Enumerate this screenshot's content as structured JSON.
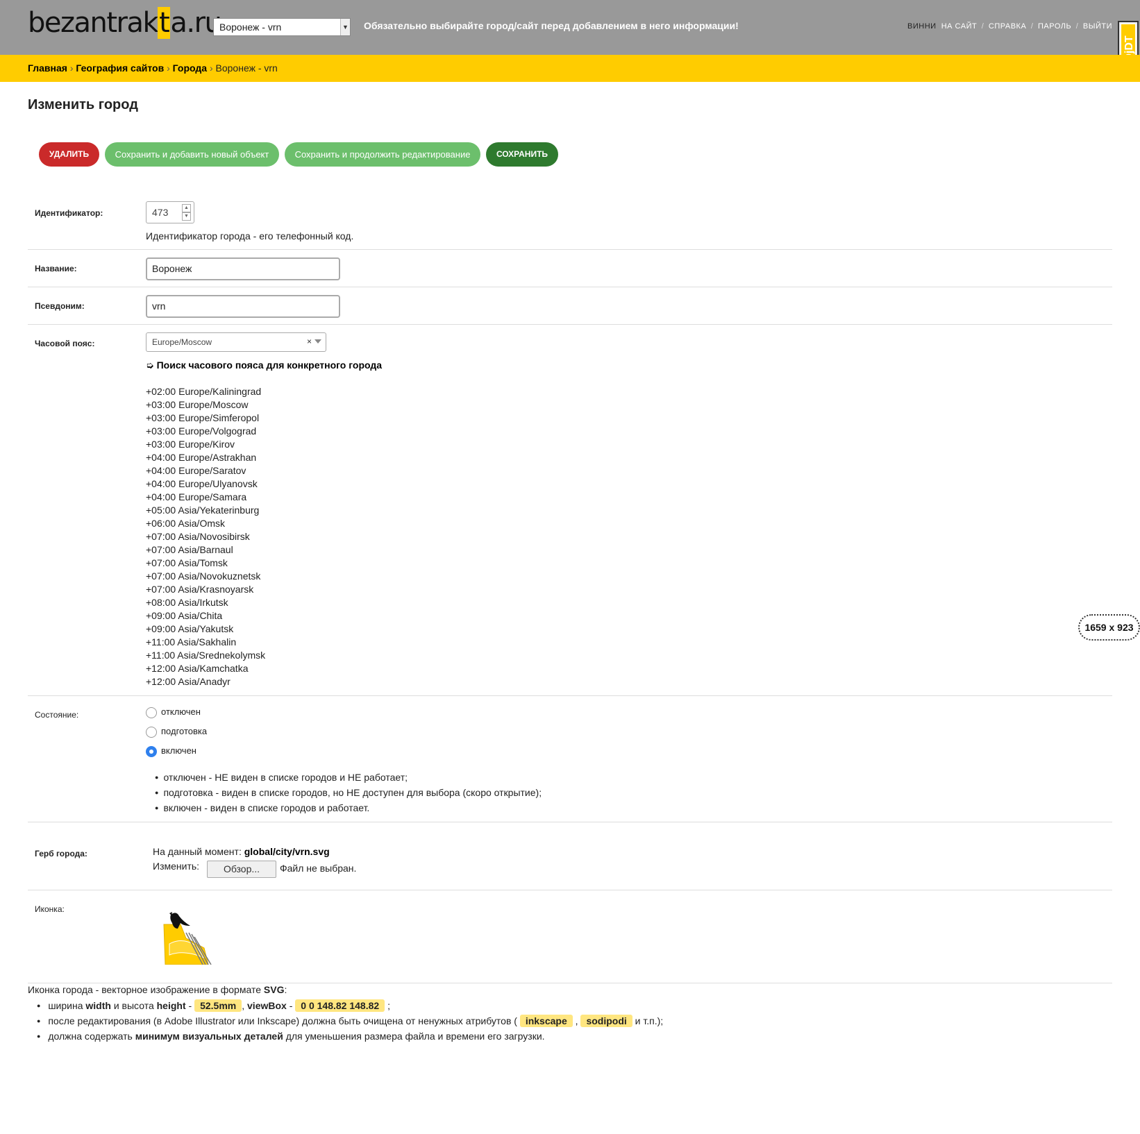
{
  "header": {
    "logo_part1": "bezantrak",
    "logo_highlight": "t",
    "logo_part2": "a.ru",
    "site_select_value": "Воронеж - vrn",
    "warning": "Обязательно выбирайте город/сайт перед добавлением в него информации!",
    "user_name": "ВИННИ",
    "nav": [
      "НА САЙТ",
      "СПРАВКА",
      "ПАРОЛЬ",
      "ВЫЙТИ"
    ],
    "nav_separator": "/",
    "debug_toolbar_label": "DjDT"
  },
  "breadcrumbs": {
    "items": [
      "Главная",
      "География сайтов",
      "Города"
    ],
    "current": "Воронеж - vrn",
    "separator": "›"
  },
  "page_title": "Изменить город",
  "actions": {
    "delete": "УДАЛИТЬ",
    "save_add": "Сохранить и добавить новый объект",
    "save_continue": "Сохранить и продолжить редактирование",
    "save": "СОХРАНИТЬ"
  },
  "form": {
    "id_label": "Идентификатор:",
    "id_value": "473",
    "id_help": "Идентификатор города - его телефонный код.",
    "name_label": "Название:",
    "name_value": "Воронеж",
    "alias_label": "Псевдоним:",
    "alias_value": "vrn",
    "tz_label": "Часовой пояс:",
    "tz_value": "Europe/Moscow",
    "tz_clear": "×",
    "tz_search_text": "➭ Поиск часового пояса для конкретного города",
    "tz_list": [
      "+02:00 Europe/Kaliningrad",
      "+03:00 Europe/Moscow",
      "+03:00 Europe/Simferopol",
      "+03:00 Europe/Volgograd",
      "+03:00 Europe/Kirov",
      "+04:00 Europe/Astrakhan",
      "+04:00 Europe/Saratov",
      "+04:00 Europe/Ulyanovsk",
      "+04:00 Europe/Samara",
      "+05:00 Asia/Yekaterinburg",
      "+06:00 Asia/Omsk",
      "+07:00 Asia/Novosibirsk",
      "+07:00 Asia/Barnaul",
      "+07:00 Asia/Tomsk",
      "+07:00 Asia/Novokuznetsk",
      "+07:00 Asia/Krasnoyarsk",
      "+08:00 Asia/Irkutsk",
      "+09:00 Asia/Chita",
      "+09:00 Asia/Yakutsk",
      "+11:00 Asia/Sakhalin",
      "+11:00 Asia/Srednekolymsk",
      "+12:00 Asia/Kamchatka",
      "+12:00 Asia/Anadyr"
    ],
    "state_label": "Состояние:",
    "state_options": [
      "отключен",
      "подготовка",
      "включен"
    ],
    "state_selected": "включен",
    "state_notes": [
      "отключен - НЕ виден в списке городов и НЕ работает;",
      "подготовка - виден в списке городов, но НЕ доступен для выбора (скоро открытие);",
      "включен - виден в списке городов и работает."
    ],
    "coat_label": "Герб города:",
    "coat_current_prefix": "На данный момент:",
    "coat_current_file": "global/city/vrn.svg",
    "coat_change_label": "Изменить:",
    "coat_browse": "Обзор...",
    "coat_file_status": "Файл не выбран.",
    "icon_label": "Иконка:"
  },
  "icon_notes": {
    "intro_prefix": "Иконка города - векторное изображение в формате",
    "intro_bold": "SVG",
    "intro_suffix": ":",
    "b1_t1": "ширина",
    "b1_b1": "width",
    "b1_t2": "и высота",
    "b1_b2": "height",
    "b1_t3": "-",
    "b1_tag1": "52.5mm",
    "b1_t4": ",",
    "b1_b3": "viewBox",
    "b1_t5": "-",
    "b1_tag2": "0 0 148.82 148.82",
    "b1_t6": ";",
    "b2_t1": "после редактирования (в Adobe Illustrator или Inkscape) должна быть очищена от ненужных атрибутов (",
    "b2_tag1": "inkscape",
    "b2_t2": ",",
    "b2_tag2": "sodipodi",
    "b2_t3": "и т.п.);",
    "b3_t1": "должна содержать",
    "b3_b1": "минимум визуальных деталей",
    "b3_t2": "для уменьшения размера файла и времени его загрузки."
  },
  "size_badge": "1659 x 923",
  "colors": {
    "header_bg": "#999999",
    "accent": "#ffcc00",
    "delete": "#ca2a2a",
    "secondary": "#6cbf6c",
    "primary": "#2e7a2e"
  }
}
